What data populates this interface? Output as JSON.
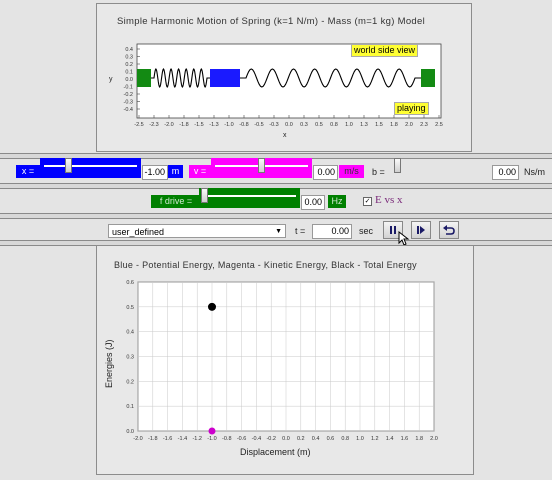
{
  "top_panel": {
    "title": "Simple Harmonic Motion of Spring (k=1 N/m) - Mass (m=1 kg) Model",
    "world_label": "world side view",
    "status_label": "playing",
    "y_axis_label": "y",
    "x_axis_label": "x",
    "y_ticks": [
      "0.4",
      "0.3",
      "0.2",
      "0.1",
      "0.0",
      "-0.1",
      "-0.2",
      "-0.3",
      "-0.4"
    ],
    "x_ticks": [
      "-2.5",
      "-2.3",
      "-2.0",
      "-1.8",
      "-1.5",
      "-1.3",
      "-1.0",
      "-0.8",
      "-0.5",
      "-0.3",
      "0.0",
      "0.3",
      "0.5",
      "0.8",
      "1.0",
      "1.3",
      "1.5",
      "1.8",
      "2.0",
      "2.3",
      "2.5"
    ],
    "mass_position_x": -1.0
  },
  "controls": {
    "x_label": "x =",
    "x_value": "-1.00",
    "x_unit": "m",
    "x_slider_fraction": 0.3,
    "v_label": "v =",
    "v_value": "0.00",
    "v_unit": "m/s",
    "v_slider_fraction": 0.5,
    "b_label": "b =",
    "b_value": "0.00",
    "b_unit": "Ns/m",
    "b_slider_fraction": 0.0,
    "f_label": "f drive =",
    "f_value": "0.00",
    "f_unit": "Hz",
    "f_slider_fraction": 0.0,
    "e_vs_x_label": "E vs x",
    "e_vs_x_checked": true,
    "preset_value": "user_defined",
    "t_label": "t =",
    "t_value": "0.00",
    "t_unit": "sec",
    "colors": {
      "x_blue": "#0000ff",
      "v_magenta": "#ff00ff",
      "f_green": "#008000",
      "mass_blue": "#1a1aff",
      "wall_green": "#138a13"
    }
  },
  "chart_data": {
    "type": "scatter",
    "title": "Blue - Potential Energy, Magenta - Kinetic Energy, Black - Total Energy",
    "xlabel": "Displacement (m)",
    "ylabel": "Energies (J)",
    "xlim": [
      -2.0,
      2.0
    ],
    "ylim": [
      0.0,
      0.6
    ],
    "x_ticks": [
      "-2.0",
      "-1.8",
      "-1.6",
      "-1.4",
      "-1.2",
      "-1.0",
      "-0.8",
      "-0.6",
      "-0.4",
      "-0.2",
      "0.0",
      "0.2",
      "0.4",
      "0.6",
      "0.8",
      "1.0",
      "1.2",
      "1.4",
      "1.6",
      "1.8",
      "2.0"
    ],
    "y_ticks": [
      "0.0",
      "0.1",
      "0.2",
      "0.3",
      "0.4",
      "0.5",
      "0.6"
    ],
    "grid": true,
    "series": [
      {
        "color": "#1a1aff",
        "x": [
          -1.0
        ],
        "y": [
          0.5
        ]
      },
      {
        "color": "#cc00cc",
        "x": [
          -1.0
        ],
        "y": [
          0.0
        ]
      },
      {
        "color": "#000000",
        "x": [
          -1.0
        ],
        "y": [
          0.5
        ]
      }
    ]
  }
}
